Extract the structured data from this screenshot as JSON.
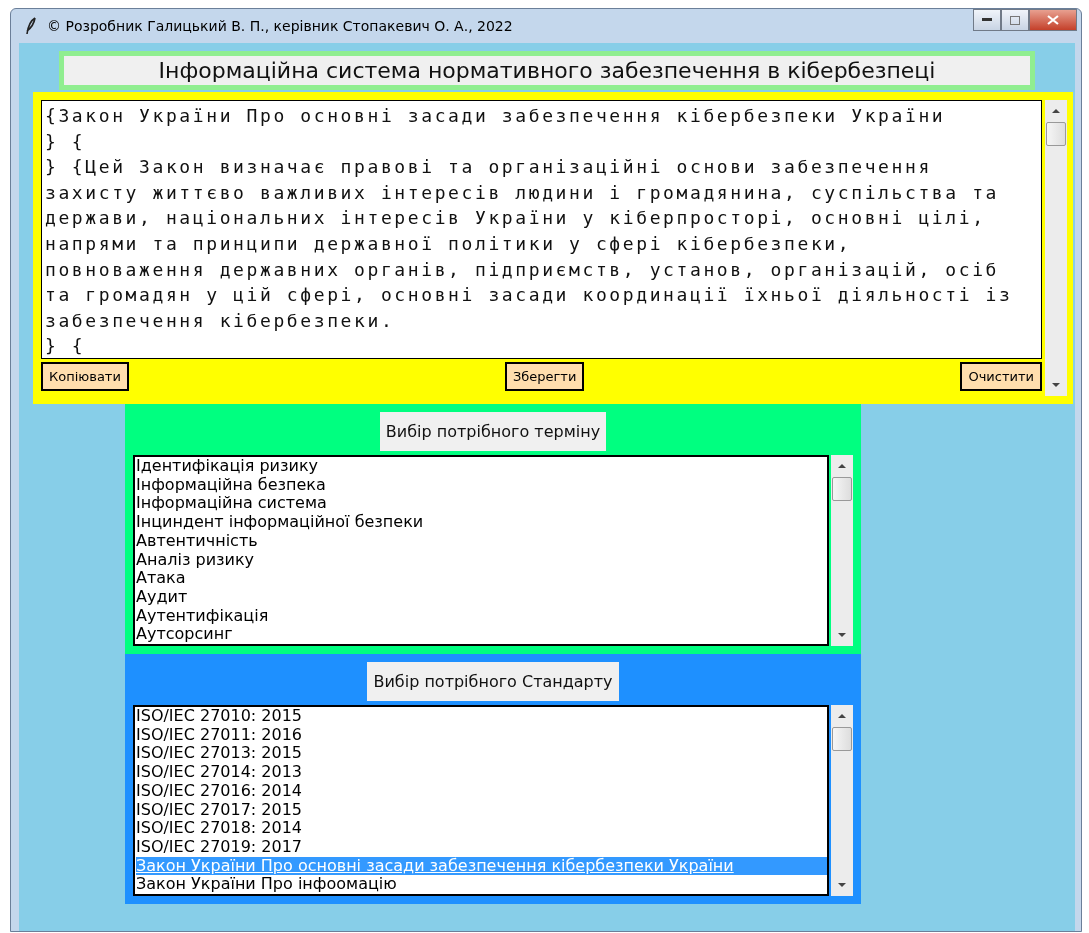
{
  "window": {
    "title": "© Розробник Галицький В. П., керівник Стопакевич О. А., 2022"
  },
  "heading": "Інформаційна система нормативного забезпечення в кібербезпеці",
  "editor": {
    "lines": [
      "{Закон України Про основні засади забезпечення кібербезпеки України",
      "} {",
      "} {Цей Закон визначає правові та організаційні основи забезпечення",
      "захисту життєво важливих інтересів людини і громадянина, суспільства та",
      "держави, національних інтересів України у кіберпросторі, основні цілі,",
      "напрями та принципи державної політики у сфері кібербезпеки,",
      "повноваження державних органів, підприємств, установ, організацій, осіб",
      "та громадян у цій сфері, основні засади координації їхньої діяльності із",
      "забезпечення кібербезпеки.",
      "} {"
    ],
    "buttons": [
      "Копіювати",
      "Зберегти",
      "Очистити"
    ]
  },
  "terms": {
    "label": "Вибір потрібного терміну",
    "items": [
      {
        "text": "Ідентифікація ризику",
        "selected": false
      },
      {
        "text": "Інформаційна безпека",
        "selected": false
      },
      {
        "text": "Інформаційна система",
        "selected": false
      },
      {
        "text": "Інциндент інформаційної безпеки",
        "selected": false
      },
      {
        "text": "Автентичність",
        "selected": false
      },
      {
        "text": "Аналіз ризику",
        "selected": false
      },
      {
        "text": "Атака",
        "selected": false
      },
      {
        "text": "Аудит",
        "selected": false
      },
      {
        "text": "Аутентифікація",
        "selected": false
      },
      {
        "text": "Аутсорсинг",
        "selected": false
      }
    ]
  },
  "standards": {
    "label": "Вибір потрібного Стандарту",
    "items": [
      {
        "text": "ISO/IEC 27010: 2015",
        "selected": false
      },
      {
        "text": "ISO/IEC 27011: 2016",
        "selected": false
      },
      {
        "text": "ISO/IEC 27013: 2015",
        "selected": false
      },
      {
        "text": "ISO/IEC 27014: 2013",
        "selected": false
      },
      {
        "text": "ISO/IEC 27016: 2014",
        "selected": false
      },
      {
        "text": "ISO/IEC 27017: 2015",
        "selected": false
      },
      {
        "text": "ISO/IEC 27018: 2014",
        "selected": false
      },
      {
        "text": "ISO/IEC 27019: 2017",
        "selected": false
      },
      {
        "text": "Закон України Про основні засади забезпечення кібербезпеки України",
        "selected": true
      },
      {
        "text": "Закон України Про інфоомацію",
        "selected": false
      }
    ]
  }
}
